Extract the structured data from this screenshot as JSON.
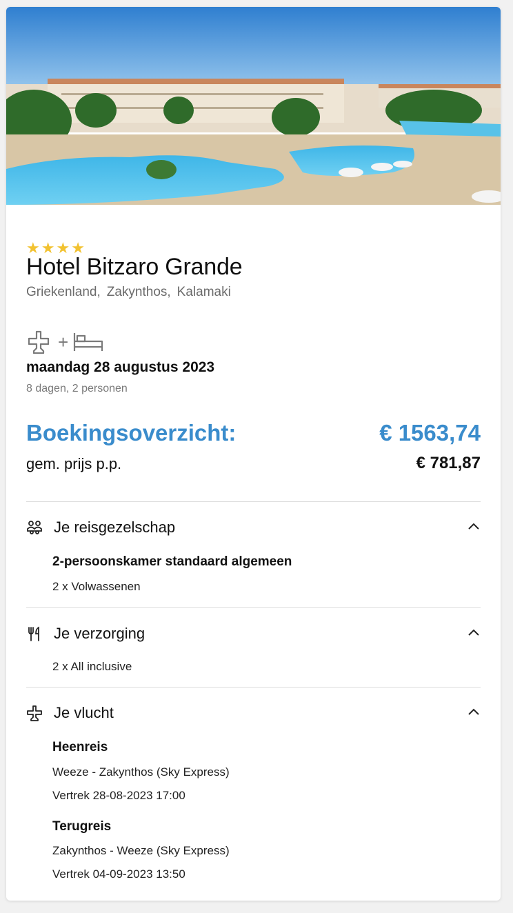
{
  "hotel": {
    "stars": 4,
    "name": "Hotel Bitzaro Grande",
    "location": [
      "Griekenland,",
      "Zakynthos,",
      "Kalamaki"
    ]
  },
  "package": {
    "icons": [
      "plane-icon",
      "bed-icon"
    ],
    "plus": "+",
    "date": "maandag 28 augustus 2023",
    "details": "8 dagen, 2 personen"
  },
  "booking": {
    "label": "Boekingsoverzicht:",
    "total": "€ 1563,74",
    "pp_label": "gem. prijs p.p.",
    "pp_value": "€ 781,87"
  },
  "sections": {
    "party": {
      "title": "Je reisgezelschap",
      "icon": "group-icon",
      "room": "2-persoonskamer standaard algemeen",
      "persons": "2 x Volwassenen"
    },
    "board": {
      "title": "Je verzorging",
      "icon": "fork-knife-icon",
      "value": "2 x All inclusive"
    },
    "flight": {
      "title": "Je vlucht",
      "icon": "plane-icon",
      "out_title": "Heenreis",
      "out_route": "Weeze - Zakynthos (Sky Express)",
      "out_departure": "Vertrek 28-08-2023 17:00",
      "ret_title": "Terugreis",
      "ret_route": "Zakynthos - Weeze (Sky Express)",
      "ret_departure": "Vertrek 04-09-2023 13:50"
    }
  },
  "colors": {
    "accent": "#3a8ccc",
    "star": "#f2c230"
  }
}
